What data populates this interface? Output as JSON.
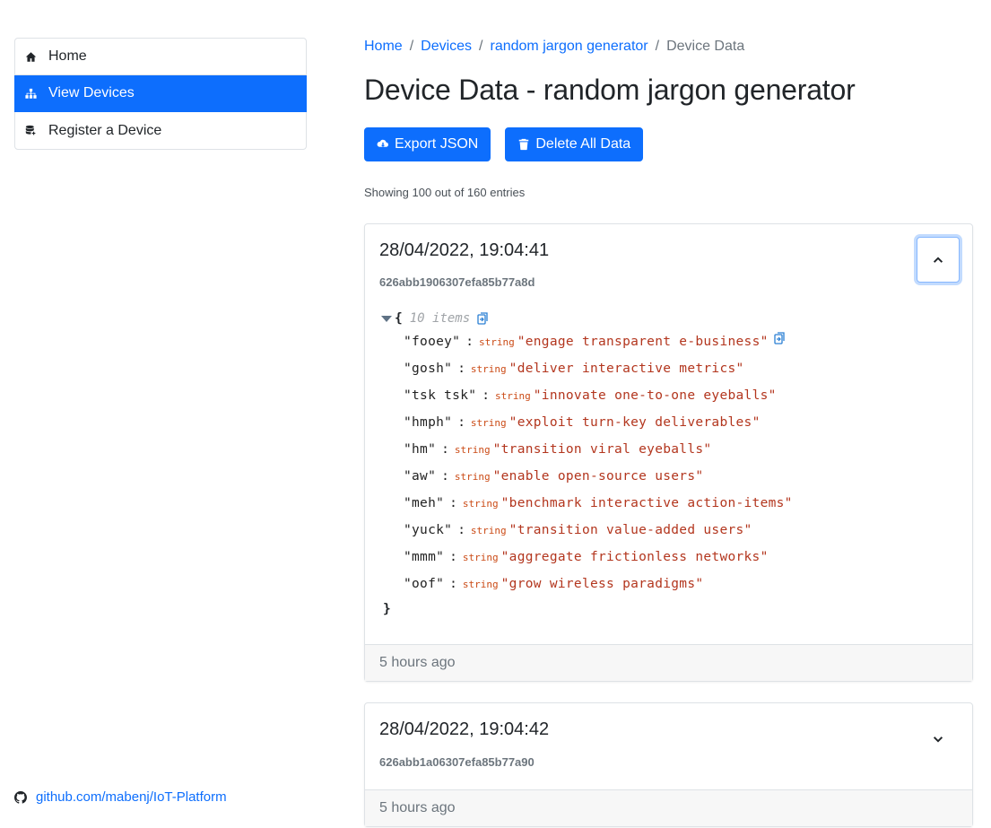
{
  "sidebar": {
    "items": [
      {
        "label": "Home",
        "icon": "home-icon"
      },
      {
        "label": "View Devices",
        "icon": "sitemap-icon",
        "active": true
      },
      {
        "label": "Register a Device",
        "icon": "database-plus-icon"
      }
    ],
    "github_link": "github.com/mabenj/IoT-Platform"
  },
  "breadcrumb": {
    "items": [
      "Home",
      "Devices",
      "random jargon generator"
    ],
    "separator": "/",
    "current": "Device Data"
  },
  "page": {
    "title": "Device Data - random jargon generator",
    "export_label": "Export JSON",
    "delete_label": "Delete All Data",
    "entries_info": "Showing 100 out of 160 entries"
  },
  "colors": {
    "primary": "#0d6efd",
    "json_string_value": "#b3361e",
    "json_type_label": "#cb4b16",
    "muted": "#6c757d"
  },
  "cards": [
    {
      "timestamp": "28/04/2022, 19:04:41",
      "id": "626abb1906307efa85b77a8d",
      "expanded": true,
      "footer": "5 hours ago",
      "json": {
        "open_brace": "{",
        "close_brace": "}",
        "count_label": "10 items",
        "rows": [
          {
            "key": "\"fooey\"",
            "colon": ":",
            "type": "string",
            "value": "\"engage transparent e-business\""
          },
          {
            "key": "\"gosh\"",
            "colon": ":",
            "type": "string",
            "value": "\"deliver interactive metrics\""
          },
          {
            "key": "\"tsk tsk\"",
            "colon": ":",
            "type": "string",
            "value": "\"innovate one-to-one eyeballs\""
          },
          {
            "key": "\"hmph\"",
            "colon": ":",
            "type": "string",
            "value": "\"exploit turn-key deliverables\""
          },
          {
            "key": "\"hm\"",
            "colon": ":",
            "type": "string",
            "value": "\"transition viral eyeballs\""
          },
          {
            "key": "\"aw\"",
            "colon": ":",
            "type": "string",
            "value": "\"enable open-source users\""
          },
          {
            "key": "\"meh\"",
            "colon": ":",
            "type": "string",
            "value": "\"benchmark interactive action-items\""
          },
          {
            "key": "\"yuck\"",
            "colon": ":",
            "type": "string",
            "value": "\"transition value-added users\""
          },
          {
            "key": "\"mmm\"",
            "colon": ":",
            "type": "string",
            "value": "\"aggregate frictionless networks\""
          },
          {
            "key": "\"oof\"",
            "colon": ":",
            "type": "string",
            "value": "\"grow wireless paradigms\""
          }
        ]
      }
    },
    {
      "timestamp": "28/04/2022, 19:04:42",
      "id": "626abb1a06307efa85b77a90",
      "expanded": false,
      "footer": "5 hours ago"
    }
  ]
}
